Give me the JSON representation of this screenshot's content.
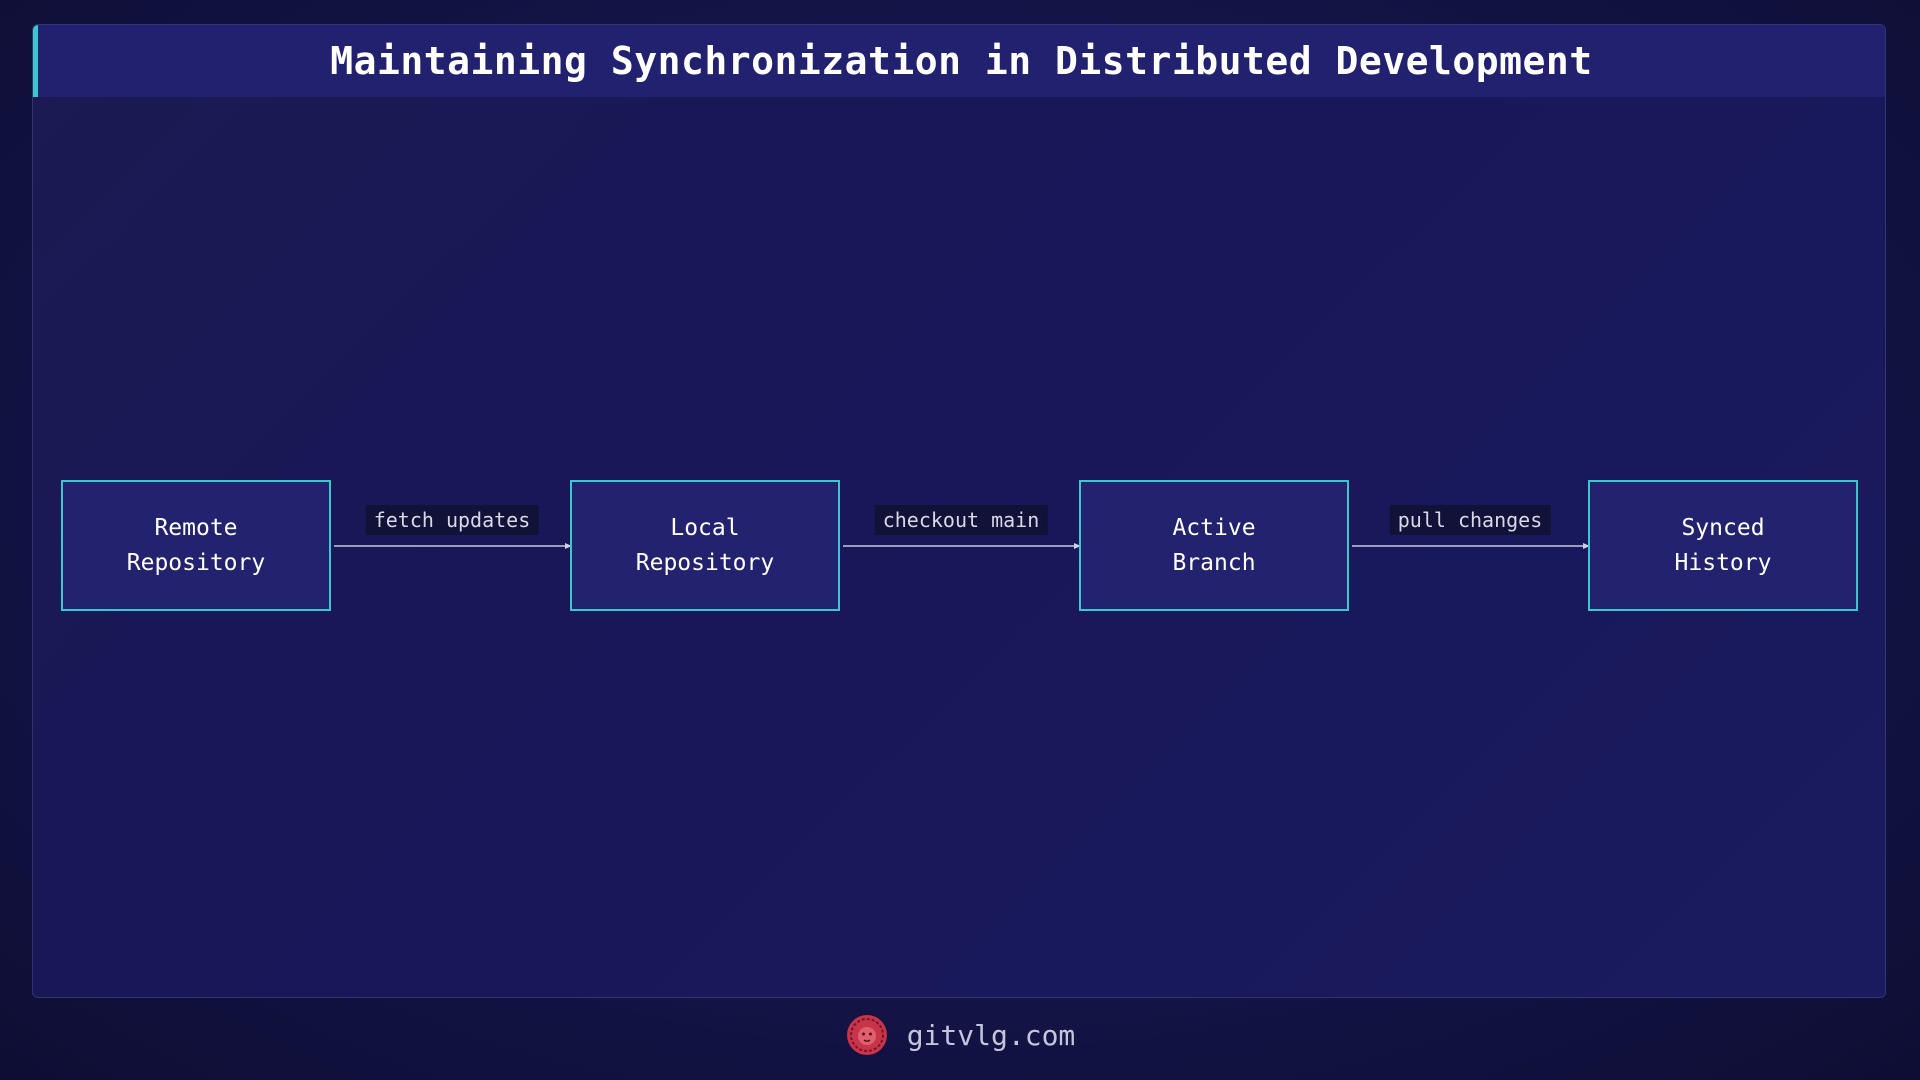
{
  "title": "Maintaining Synchronization in Distributed Development",
  "nodes": [
    {
      "label": "Remote\nRepository"
    },
    {
      "label": "Local\nRepository"
    },
    {
      "label": "Active\nBranch"
    },
    {
      "label": "Synced\nHistory"
    }
  ],
  "edges": [
    {
      "from": 0,
      "to": 1,
      "label": "fetch updates"
    },
    {
      "from": 1,
      "to": 2,
      "label": "checkout main"
    },
    {
      "from": 2,
      "to": 3,
      "label": "pull changes"
    }
  ],
  "footer": {
    "site": "gitvlg.com",
    "logo_icon": "lion-logo-icon"
  },
  "colors": {
    "accent": "#3cc6cf",
    "node_fill": "#23226f",
    "background": "#16164e",
    "logo": "#c8344a"
  }
}
